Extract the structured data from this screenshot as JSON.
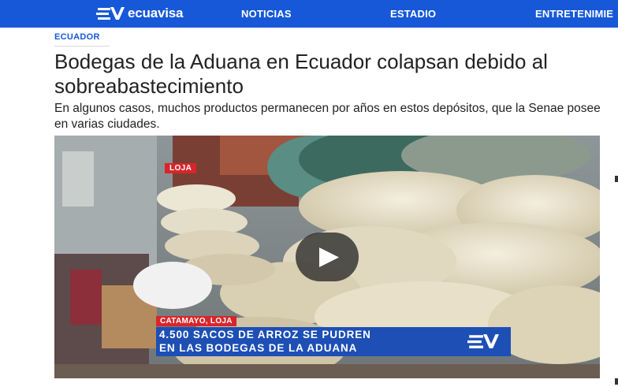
{
  "header": {
    "brand": "ecuavisa",
    "logo_icon": "ecuavisa-logo-icon",
    "nav": {
      "noticias": "NOTICIAS",
      "estadio": "ESTADIO",
      "entretenimiento": "ENTRETENIMIE"
    },
    "background_color": "#1658d8"
  },
  "article": {
    "category": "ECUADOR",
    "title": "Bodegas de la Aduana en Ecuador colapsan debido al sobreabastecimiento",
    "subtitle": "En algunos casos, muchos productos permanecen por años en estos depósitos, que la Senae posee en varias ciudades."
  },
  "video": {
    "location_badge": "LOJA",
    "play_icon": "play-icon",
    "lower_third": {
      "place": "CATAMAYO, LOJA",
      "line1": "4.500 SACOS DE ARROZ SE PUDREN",
      "line2": "EN LAS BODEGAS DE LA ADUANA",
      "logo_icon": "ecuavisa-logo-icon"
    },
    "accent_red": "#d7262b",
    "accent_blue": "#1d4fb5"
  }
}
